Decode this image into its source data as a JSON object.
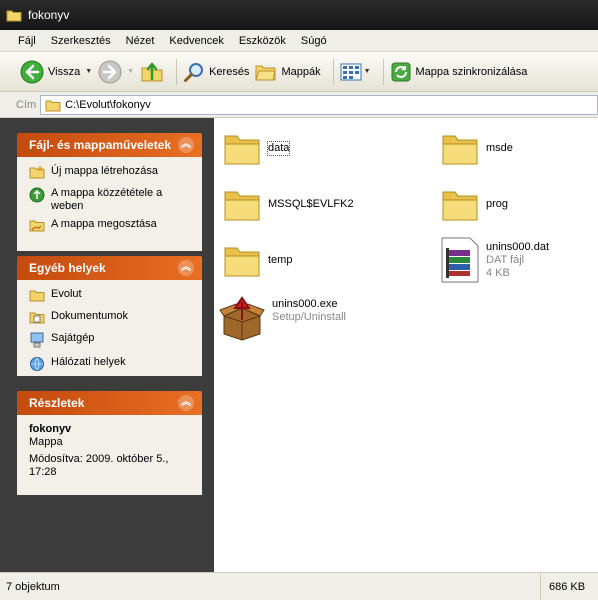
{
  "window": {
    "title": "fokonyv",
    "icon": "folder-icon"
  },
  "menu": [
    "Fájl",
    "Szerkesztés",
    "Nézet",
    "Kedvencek",
    "Eszközök",
    "Súgó"
  ],
  "toolbar": {
    "back_label": "Vissza",
    "search_label": "Keresés",
    "folders_label": "Mappák",
    "sync_label": "Mappa szinkronizálása"
  },
  "address": {
    "label": "Cím",
    "path": "C:\\Evolut\\fokonyv"
  },
  "panels": {
    "tasks": {
      "title": "Fájl- és mappaműveletek",
      "items": [
        {
          "label": "Új mappa létrehozása",
          "icon": "new-folder-icon"
        },
        {
          "label": "A mappa közzététele a weben",
          "icon": "publish-web-icon"
        },
        {
          "label": "A mappa megosztása",
          "icon": "share-folder-icon"
        }
      ]
    },
    "places": {
      "title": "Egyéb helyek",
      "items": [
        {
          "label": "Evolut",
          "icon": "folder-icon"
        },
        {
          "label": "Dokumentumok",
          "icon": "documents-icon"
        },
        {
          "label": "Sajátgép",
          "icon": "my-computer-icon"
        },
        {
          "label": "Hálózati helyek",
          "icon": "network-places-icon"
        }
      ]
    },
    "details": {
      "title": "Részletek",
      "name": "fokonyv",
      "type": "Mappa",
      "modified": "Módosítva: 2009. október 5., 17:28"
    }
  },
  "files": [
    {
      "name": "data",
      "kind": "folder"
    },
    {
      "name": "msde",
      "kind": "folder"
    },
    {
      "name": "MSSQL$EVLFK2",
      "kind": "folder"
    },
    {
      "name": "prog",
      "kind": "folder"
    },
    {
      "name": "temp",
      "kind": "folder"
    },
    {
      "name": "unins000.dat",
      "kind": "file",
      "type": "DAT fájl",
      "size": "4 KB"
    },
    {
      "name": "unins000.exe",
      "kind": "exe",
      "type": "Setup/Uninstall"
    }
  ],
  "status": {
    "count": "7 objektum",
    "size": "686 KB"
  },
  "colors": {
    "panel_header": "#d9581a",
    "titlebar": "#1f1f1f",
    "folder": "#f3d46a"
  }
}
